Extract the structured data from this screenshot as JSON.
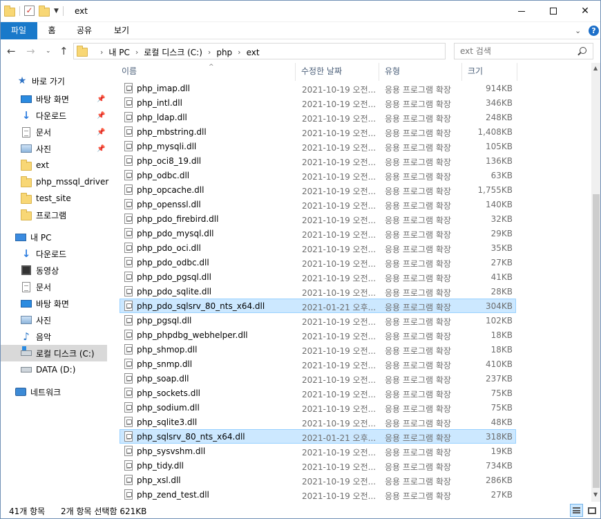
{
  "window": {
    "title": "ext",
    "controls": {
      "minimize": "minimize-icon",
      "maximize": "maximize-icon",
      "close": "close-icon"
    }
  },
  "ribbon": {
    "tabs": [
      {
        "label": "파일",
        "active": true
      },
      {
        "label": "홈"
      },
      {
        "label": "공유"
      },
      {
        "label": "보기"
      }
    ],
    "help": "?"
  },
  "address": {
    "crumbs": [
      "내 PC",
      "로컬 디스크 (C:)",
      "php",
      "ext"
    ]
  },
  "search": {
    "placeholder": "ext 검색"
  },
  "navpane": {
    "quick_access": "바로 가기",
    "pinned": [
      {
        "label": "바탕 화면",
        "icon": "desktop-icon",
        "pinned": true
      },
      {
        "label": "다운로드",
        "icon": "download-icon",
        "pinned": true
      },
      {
        "label": "문서",
        "icon": "document-icon",
        "pinned": true
      },
      {
        "label": "사진",
        "icon": "pictures-icon",
        "pinned": true
      },
      {
        "label": "ext",
        "icon": "folder-icon"
      },
      {
        "label": "php_mssql_driver",
        "icon": "folder-icon"
      },
      {
        "label": "test_site",
        "icon": "folder-icon"
      },
      {
        "label": "프로그램",
        "icon": "folder-icon"
      }
    ],
    "this_pc": "내 PC",
    "pc_items": [
      {
        "label": "다운로드",
        "icon": "download-icon"
      },
      {
        "label": "동영상",
        "icon": "video-icon"
      },
      {
        "label": "문서",
        "icon": "document-icon"
      },
      {
        "label": "바탕 화면",
        "icon": "desktop-icon"
      },
      {
        "label": "사진",
        "icon": "pictures-icon"
      },
      {
        "label": "음악",
        "icon": "music-icon"
      },
      {
        "label": "로컬 디스크 (C:)",
        "icon": "drive-icon",
        "selected": true
      },
      {
        "label": "DATA (D:)",
        "icon": "drive-icon"
      }
    ],
    "network": "네트워크"
  },
  "columns": {
    "name": "이름",
    "date": "수정한 날짜",
    "type": "유형",
    "size": "크기"
  },
  "files": [
    {
      "name": "php_imap.dll",
      "date": "2021-10-19 오전...",
      "type": "응용 프로그램 확장",
      "size": "914KB"
    },
    {
      "name": "php_intl.dll",
      "date": "2021-10-19 오전...",
      "type": "응용 프로그램 확장",
      "size": "346KB"
    },
    {
      "name": "php_ldap.dll",
      "date": "2021-10-19 오전...",
      "type": "응용 프로그램 확장",
      "size": "248KB"
    },
    {
      "name": "php_mbstring.dll",
      "date": "2021-10-19 오전...",
      "type": "응용 프로그램 확장",
      "size": "1,408KB"
    },
    {
      "name": "php_mysqli.dll",
      "date": "2021-10-19 오전...",
      "type": "응용 프로그램 확장",
      "size": "105KB"
    },
    {
      "name": "php_oci8_19.dll",
      "date": "2021-10-19 오전...",
      "type": "응용 프로그램 확장",
      "size": "136KB"
    },
    {
      "name": "php_odbc.dll",
      "date": "2021-10-19 오전...",
      "type": "응용 프로그램 확장",
      "size": "63KB"
    },
    {
      "name": "php_opcache.dll",
      "date": "2021-10-19 오전...",
      "type": "응용 프로그램 확장",
      "size": "1,755KB"
    },
    {
      "name": "php_openssl.dll",
      "date": "2021-10-19 오전...",
      "type": "응용 프로그램 확장",
      "size": "140KB"
    },
    {
      "name": "php_pdo_firebird.dll",
      "date": "2021-10-19 오전...",
      "type": "응용 프로그램 확장",
      "size": "32KB"
    },
    {
      "name": "php_pdo_mysql.dll",
      "date": "2021-10-19 오전...",
      "type": "응용 프로그램 확장",
      "size": "29KB"
    },
    {
      "name": "php_pdo_oci.dll",
      "date": "2021-10-19 오전...",
      "type": "응용 프로그램 확장",
      "size": "35KB"
    },
    {
      "name": "php_pdo_odbc.dll",
      "date": "2021-10-19 오전...",
      "type": "응용 프로그램 확장",
      "size": "27KB"
    },
    {
      "name": "php_pdo_pgsql.dll",
      "date": "2021-10-19 오전...",
      "type": "응용 프로그램 확장",
      "size": "41KB"
    },
    {
      "name": "php_pdo_sqlite.dll",
      "date": "2021-10-19 오전...",
      "type": "응용 프로그램 확장",
      "size": "28KB"
    },
    {
      "name": "php_pdo_sqlsrv_80_nts_x64.dll",
      "date": "2021-01-21 오후...",
      "type": "응용 프로그램 확장",
      "size": "304KB",
      "selected": true
    },
    {
      "name": "php_pgsql.dll",
      "date": "2021-10-19 오전...",
      "type": "응용 프로그램 확장",
      "size": "102KB"
    },
    {
      "name": "php_phpdbg_webhelper.dll",
      "date": "2021-10-19 오전...",
      "type": "응용 프로그램 확장",
      "size": "18KB"
    },
    {
      "name": "php_shmop.dll",
      "date": "2021-10-19 오전...",
      "type": "응용 프로그램 확장",
      "size": "18KB"
    },
    {
      "name": "php_snmp.dll",
      "date": "2021-10-19 오전...",
      "type": "응용 프로그램 확장",
      "size": "410KB"
    },
    {
      "name": "php_soap.dll",
      "date": "2021-10-19 오전...",
      "type": "응용 프로그램 확장",
      "size": "237KB"
    },
    {
      "name": "php_sockets.dll",
      "date": "2021-10-19 오전...",
      "type": "응용 프로그램 확장",
      "size": "75KB"
    },
    {
      "name": "php_sodium.dll",
      "date": "2021-10-19 오전...",
      "type": "응용 프로그램 확장",
      "size": "75KB"
    },
    {
      "name": "php_sqlite3.dll",
      "date": "2021-10-19 오전...",
      "type": "응용 프로그램 확장",
      "size": "48KB"
    },
    {
      "name": "php_sqlsrv_80_nts_x64.dll",
      "date": "2021-01-21 오후...",
      "type": "응용 프로그램 확장",
      "size": "318KB",
      "selected": true
    },
    {
      "name": "php_sysvshm.dll",
      "date": "2021-10-19 오전...",
      "type": "응용 프로그램 확장",
      "size": "19KB"
    },
    {
      "name": "php_tidy.dll",
      "date": "2021-10-19 오전...",
      "type": "응용 프로그램 확장",
      "size": "734KB"
    },
    {
      "name": "php_xsl.dll",
      "date": "2021-10-19 오전...",
      "type": "응용 프로그램 확장",
      "size": "286KB"
    },
    {
      "name": "php_zend_test.dll",
      "date": "2021-10-19 오전...",
      "type": "응용 프로그램 확장",
      "size": "27KB"
    }
  ],
  "status": {
    "item_count": "41개 항목",
    "selection": "2개 항목 선택함 621KB"
  },
  "colors": {
    "accent": "#1979ca",
    "selection": "#cce8ff",
    "selection_border": "#99d1ff",
    "nav_selected": "#d9d9d9"
  }
}
